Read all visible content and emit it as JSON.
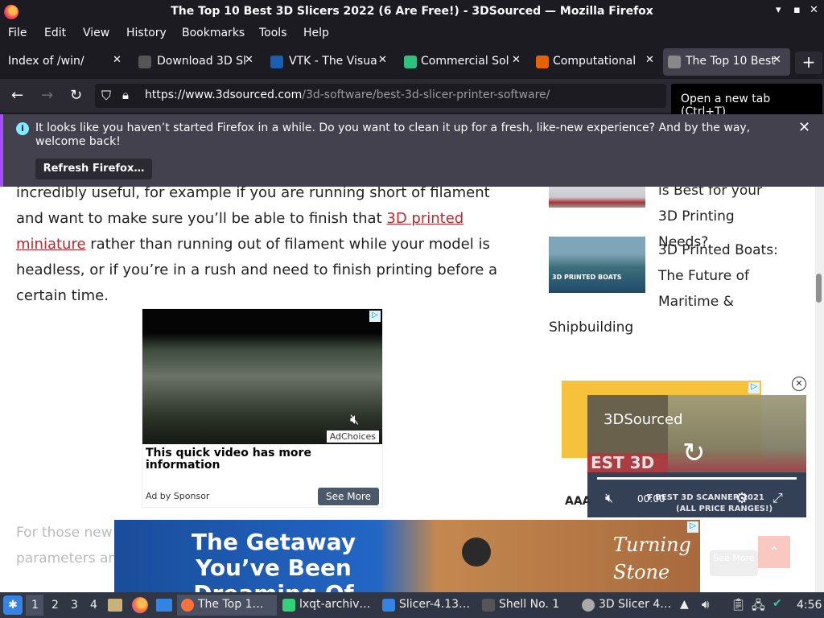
{
  "window": {
    "title": "The Top 10 Best 3D Slicers 2022 (6 Are Free!) - 3DSourced — Mozilla Firefox",
    "controls": [
      "▾",
      "▪",
      "✕"
    ]
  },
  "menu": [
    "File",
    "Edit",
    "View",
    "History",
    "Bookmarks",
    "Tools",
    "Help"
  ],
  "tabs": [
    {
      "label": "Index of /win/",
      "icon_color": ""
    },
    {
      "label": "Download 3D Sl",
      "icon_color": "#555"
    },
    {
      "label": "VTK - The Visua",
      "icon_color": "#1a5fb4"
    },
    {
      "label": "Commercial Sol",
      "icon_color": "#2ec27e"
    },
    {
      "label": "Computational",
      "icon_color": "#e66100"
    },
    {
      "label": "The Top 10 Best",
      "icon_color": "#888"
    }
  ],
  "nav": {
    "url_host": "https://www.3dsourced.com",
    "url_path": "/3d-software/best-3d-slicer-printer-software/",
    "tooltip": "Open a new tab (Ctrl+T)"
  },
  "notification": {
    "message": "It looks like you haven’t started Firefox in a while. Do you want to clean it up for a fresh, like-new experience? And by the way, welcome back!",
    "button": "Refresh Firefox…"
  },
  "article": {
    "part1": "incredibly useful, for example if you are running short of filament and want to make sure you’ll be able to finish that ",
    "link": "3D printed miniature",
    "part2": " rather than running out of filament while your model is headless, or if you’re in a rush and need to finish printing before a certain time.",
    "faded": "For those new t",
    "faded2": "parameters and"
  },
  "sidebar": {
    "item1": "is Best for your 3D Printing Needs?",
    "item2": "3D Printed Boats: The Future of Maritime &",
    "item2_cont": "Shipbuilding",
    "thumb2_caption": "3D PRINTED BOATS"
  },
  "ad1": {
    "adchoices": "AdChoices",
    "title": "This quick video has more information",
    "sponsor": "Ad by Sponsor",
    "button": "See More"
  },
  "video_player": {
    "title": "3DSourced",
    "time": "00:00",
    "banner": "EST 3D",
    "side_label": "AAA",
    "caption1": "T BEST 3D SCANNER 2021",
    "caption2": "(ALL PRICE RANGES!)"
  },
  "bottom_ad": {
    "headline": "The Getaway You’ve Been Dreaming Of",
    "brand": "Turning Stone",
    "see_more": "See More"
  },
  "taskbar": {
    "desktops": [
      "1",
      "2",
      "3",
      "4"
    ],
    "tasks": [
      {
        "label": "The Top 1…",
        "icon_color": "#ff7139"
      },
      {
        "label": "lxqt-archiv…",
        "icon_color": "#33d17a"
      },
      {
        "label": "Slicer-4.13…",
        "icon_color": "#3584e4"
      },
      {
        "label": "Shell No. 1",
        "icon_color": "#555"
      },
      {
        "label": "3D Slicer 4…",
        "icon_color": "#aaa"
      }
    ],
    "clock": "4:56"
  }
}
